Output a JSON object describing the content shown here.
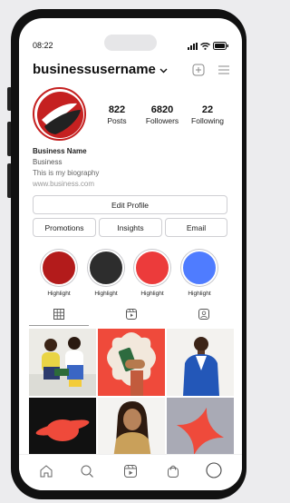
{
  "status": {
    "time": "08:22"
  },
  "header": {
    "username": "businessusername"
  },
  "stats": [
    {
      "num": "822",
      "label": "Posts"
    },
    {
      "num": "6820",
      "label": "Followers"
    },
    {
      "num": "22",
      "label": "Following"
    }
  ],
  "bio": {
    "name": "Business Name",
    "category": "Business",
    "text": "This is my biography",
    "link": "www.business.com"
  },
  "buttons": {
    "edit": "Edit Profile",
    "promotions": "Promotions",
    "insights": "Insights",
    "email": "Email"
  },
  "highlights": [
    {
      "label": "Highlight",
      "color": "#b31b1b"
    },
    {
      "label": "Highlight",
      "color": "#2d2d2d"
    },
    {
      "label": "Highlight",
      "color": "#ec3b3b"
    },
    {
      "label": "Highlight",
      "color": "#4f7cff"
    }
  ],
  "colors": {
    "brand_red": "#c52020",
    "border": "#cfcfd3"
  }
}
